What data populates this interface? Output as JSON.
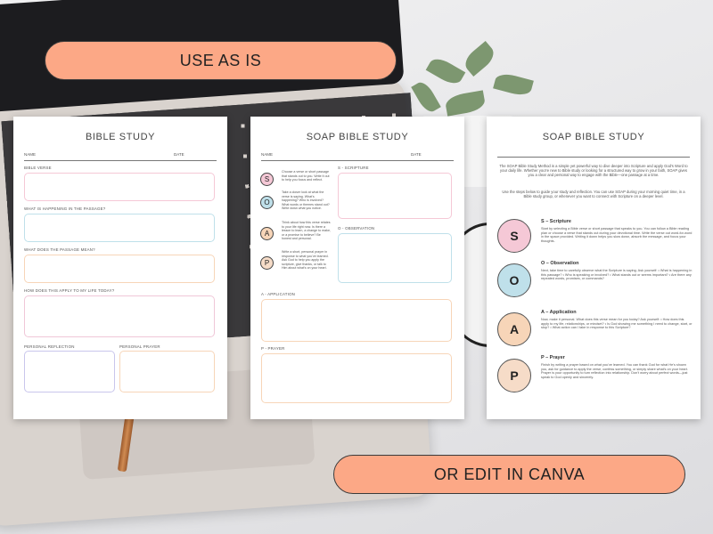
{
  "banners": {
    "top": "USE AS IS",
    "bottom": "OR EDIT IN CANVA"
  },
  "colors": {
    "accent": "#fca886",
    "pink": "#f5c8d6",
    "blue": "#bfe0ea",
    "peach": "#f7d5b8",
    "lavender": "#c9c6ec"
  },
  "page1": {
    "title": "BIBLE STUDY",
    "name": "NAME",
    "date": "DATE",
    "bible_verse": "BIBLE VERSE",
    "happening": "WHAT IS HAPPENING IN THE PASSAGE?",
    "mean": "WHAT DOES THE PASSAGE MEAN?",
    "apply": "HOW DOES THIS APPLY TO MY LIFE TODAY?",
    "reflection": "PERSONAL REFLECTION",
    "prayer": "PERSONAL PRAYER"
  },
  "page2": {
    "title": "SOAP BIBLE STUDY",
    "name": "NAME",
    "date": "DATE",
    "letters": [
      "S",
      "O",
      "A",
      "P"
    ],
    "tips": [
      "Choose a verse or short passage that stands out to you. Write it out to help you focus and reflect.",
      "Take a closer look at what the verse is saying. What's happening? Who is involved? What words or themes stand out? Write down what you notice.",
      "Think about how this verse relates to your life right now. Is there a lesson to learn, a change to make, or a promise to believe? Be honest and personal.",
      "Write a short, personal prayer in response to what you've learned. Ask God to help you apply the scripture, give thanks, or talk to Him about what's on your heart."
    ],
    "scripture": "S - SCRIPTURE",
    "observation": "O - OBSERVATION",
    "application": "A - APPLICATION",
    "prayer": "P - PRAYER"
  },
  "page3": {
    "title": "SOAP BIBLE STUDY",
    "intro1": "The SOAP Bible Study Method is a simple yet powerful way to dive deeper into Scripture and apply God's Word to your daily life. Whether you're new to Bible study or looking for a structured way to grow in your faith, SOAP gives you a clear and personal way to engage with the Bible—one passage at a time.",
    "intro2": "Use the steps below to guide your study and reflection. You can use SOAP during your morning quiet time, in a Bible study group, or whenever you want to connect with Scripture on a deeper level.",
    "sections": [
      {
        "letter": "S",
        "title": "S – Scripture",
        "body": "Start by selecting a Bible verse or short passage that speaks to you. You can follow a Bible reading plan or choose a verse that stands out during your devotional time. Write the verse out word-for-word in the space provided. Writing it down helps you slow down, absorb the message, and focus your thoughts."
      },
      {
        "letter": "O",
        "title": "O – Observation",
        "body": "Next, take time to carefully observe what the Scripture is saying. Ask yourself: • What is happening in this passage? • Who is speaking or involved? • What stands out or seems important? • Are there any repeated words, promises, or commands?"
      },
      {
        "letter": "A",
        "title": "A – Application",
        "body": "Now, make it personal. What does this verse mean for you today? Ask yourself: • How does this apply to my life, relationships, or mindset? • Is God showing me something I need to change, start, or stop? • What action can I take in response to this Scripture?"
      },
      {
        "letter": "P",
        "title": "P – Prayer",
        "body": "Finish by writing a prayer based on what you've learned. You can thank God for what He's shown you, ask for guidance to apply the verse, confess something, or simply share what's on your heart. Prayer is your opportunity to turn reflection into relationship. Don't worry about perfect words—just speak to God openly and sincerely."
      }
    ]
  }
}
